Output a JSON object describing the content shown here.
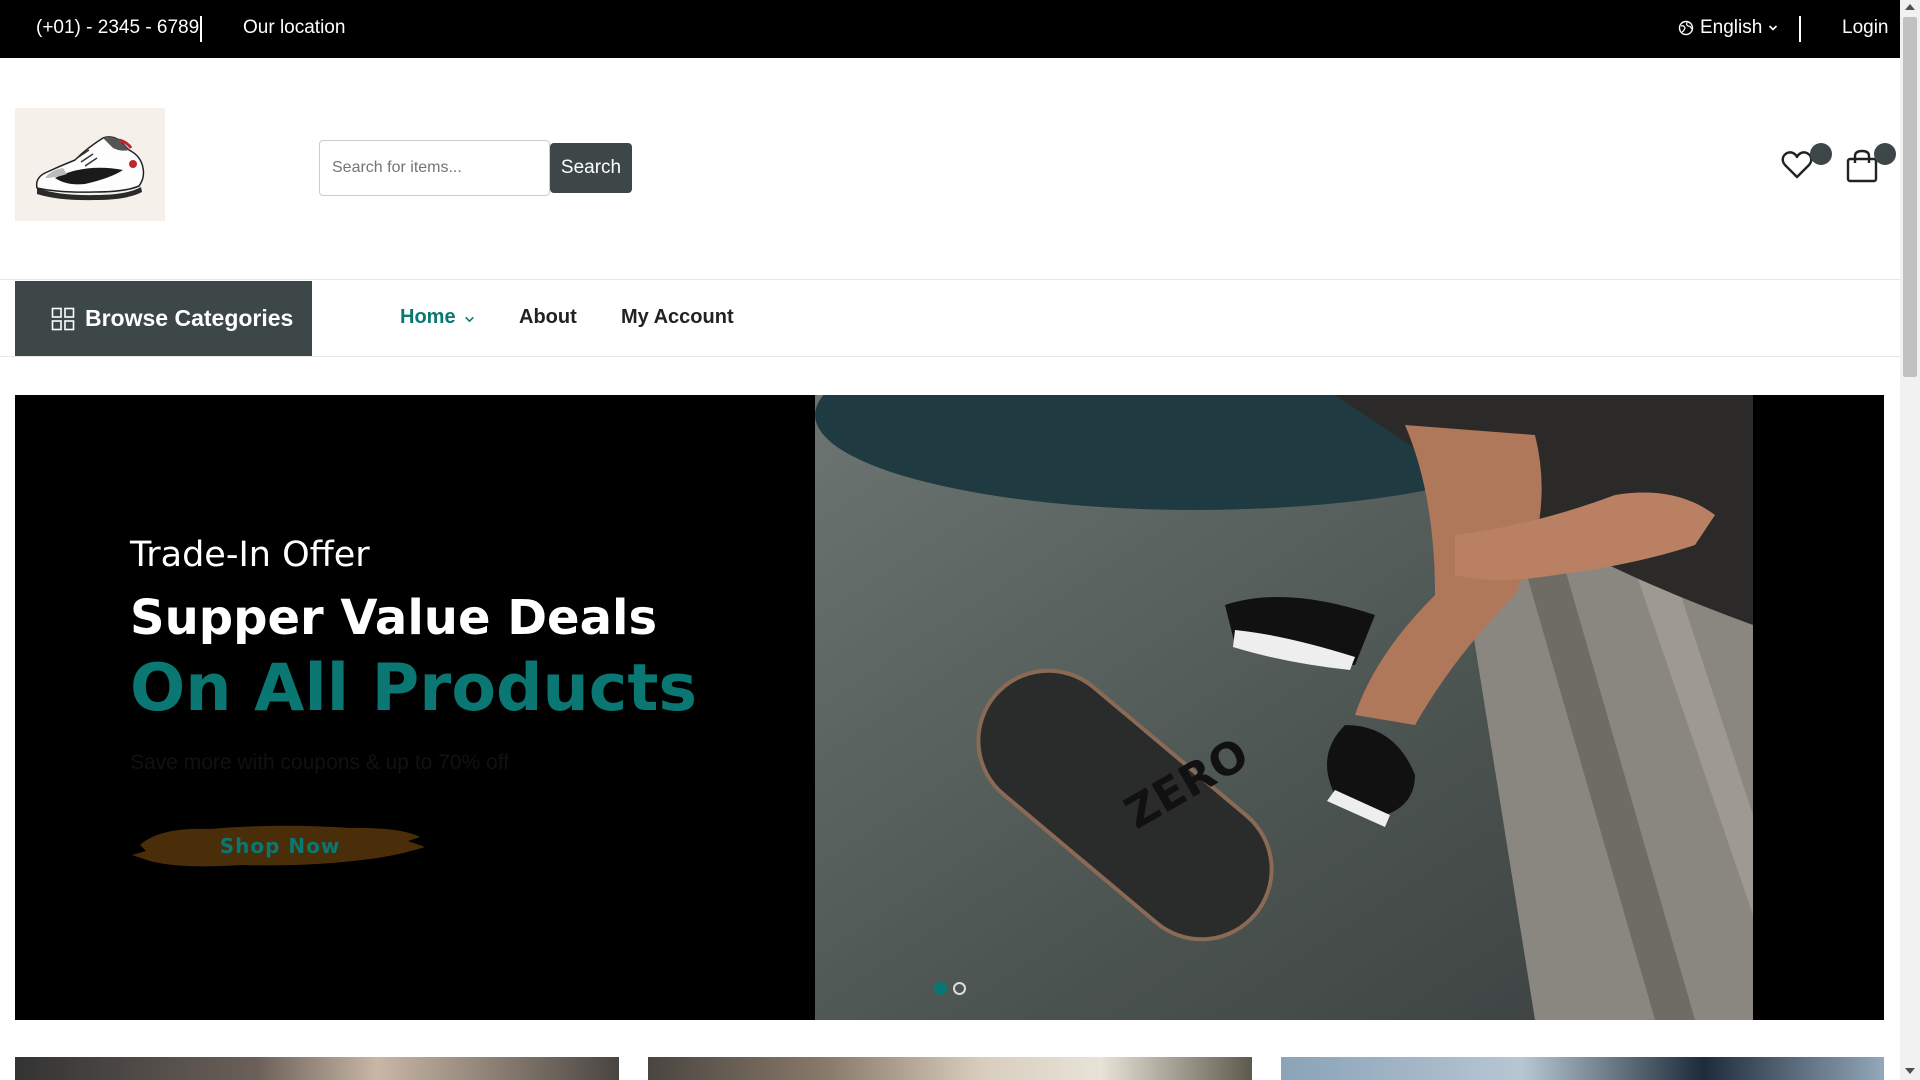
{
  "topbar": {
    "phone": "(+01) - 2345 - 6789",
    "location": "Our location",
    "language": "English",
    "login": "Login"
  },
  "header": {
    "logo_icon": "sneaker-logo",
    "search_placeholder": "Search for items...",
    "search_button": "Search",
    "wishlist_icon": "heart-icon",
    "cart_icon": "shopping-bag-icon"
  },
  "nav": {
    "browse_label": "Browse Categories",
    "items": [
      {
        "label": "Home",
        "active": true,
        "has_dropdown": true
      },
      {
        "label": "About",
        "active": false
      },
      {
        "label": "My Account",
        "active": false
      }
    ]
  },
  "hero": {
    "pre_title": "Trade-In Offer",
    "title": "Supper Value Deals",
    "title_highlight": "On All Products",
    "subtitle": "Save more with coupons & up to 70% off",
    "cta": "Shop Now",
    "slides": 2,
    "active_slide": 1
  },
  "colors": {
    "accent": "#0a7773",
    "dark": "#3e4747",
    "topbar": "#000000",
    "brush": "#4a2e0a"
  }
}
